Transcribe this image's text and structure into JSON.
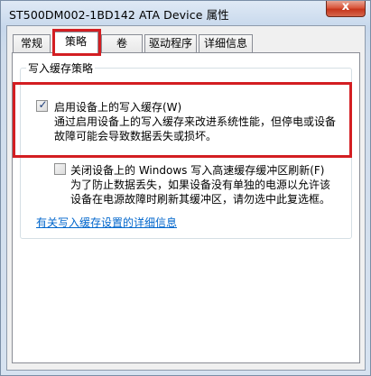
{
  "window": {
    "title": "ST500DM002-1BD142 ATA Device 属性",
    "close_label": "x"
  },
  "tabs": [
    {
      "label": "常规",
      "active": false
    },
    {
      "label": "策略",
      "active": true
    },
    {
      "label": "卷",
      "active": false
    },
    {
      "label": "驱动程序",
      "active": false
    },
    {
      "label": "详细信息",
      "active": false
    }
  ],
  "write_cache": {
    "group_title": "写入缓存策略",
    "enable_option": {
      "checked": true,
      "label": "启用设备上的写入缓存(W)",
      "description": [
        "通过启用设备上的写入缓存来改进系统性能，但停电或设备",
        "故障可能会导致数据丢失或损坏。"
      ]
    },
    "flush_option": {
      "checked": false,
      "label": "关闭设备上的 Windows 写入高速缓存缓冲区刷新(F)",
      "description": [
        "为了防止数据丢失，如果设备没有单独的电源以允许该",
        "设备在电源故障时刷新其缓冲区，请勿选中此复选框。"
      ]
    }
  },
  "more_info_link": "有关写入缓存设置的详细信息",
  "colors": {
    "highlight_red": "#d31e22",
    "link_blue": "#0066cc"
  }
}
